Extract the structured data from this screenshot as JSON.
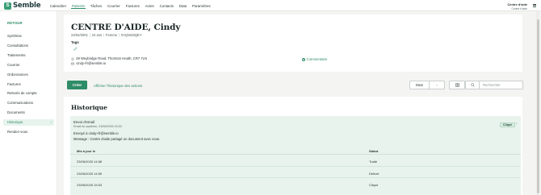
{
  "app": {
    "brand": "Semble",
    "nav": [
      "Calendrier",
      "Patients",
      "Tâches",
      "Courrier",
      "Factures",
      "Actes",
      "Contacts",
      "Data",
      "Paramètres"
    ],
    "active_nav": "Patients",
    "user": {
      "name": "Centre d'aide",
      "sub": "Centre d'aide"
    }
  },
  "sidebar": {
    "back": "RETOUR",
    "items": [
      {
        "label": "Synthèse"
      },
      {
        "label": "Consultations"
      },
      {
        "label": "Traitements"
      },
      {
        "label": "Courrier"
      },
      {
        "label": "Ordonnances"
      },
      {
        "label": "Factures"
      },
      {
        "label": "Relevés de compte"
      },
      {
        "label": "Communications"
      },
      {
        "label": "Documents"
      },
      {
        "label": "Historique",
        "active": true
      },
      {
        "label": "Rendez-vous"
      }
    ]
  },
  "patient": {
    "name": "CENTRE D'AIDE, Cindy",
    "dob": "24/04/2001",
    "age": "24 ans",
    "sex": "Femme",
    "id": "#AQW26QEY",
    "tags_label": "Tags",
    "address": "29 Weybridge Road, Thornton Heath, CR7 7LN",
    "email": "cindy+fr@semble.io",
    "comment_label": "Commentaire"
  },
  "toolbar": {
    "create": "Créer",
    "history_link": "Afficher l'historique des actions",
    "date_filter": "Date",
    "sort_dir": "↓",
    "search_placeholder": "Rechercher"
  },
  "history": {
    "title": "Historique",
    "event": {
      "title": "Envoi d'email",
      "subtitle": "Email du système, 23/06/2025 15:03",
      "status": "Cliqué",
      "line1": "Envoyé à cindy+fr@semble.io",
      "line2": "Message : Centre d'aide partagé un document avec vous.",
      "columns": [
        "Mis à jour le",
        "Statut"
      ],
      "rows": [
        {
          "date": "23/06/2025 14:58",
          "status": "Traité"
        },
        {
          "date": "23/06/2025 14:59",
          "status": "Délivré"
        },
        {
          "date": "23/06/2025 15:03",
          "status": "Cliqué"
        }
      ]
    }
  },
  "colors": {
    "accent": "#2e8c66",
    "event_bg": "#e8f3ed",
    "page_bg": "#f4f4f2"
  }
}
